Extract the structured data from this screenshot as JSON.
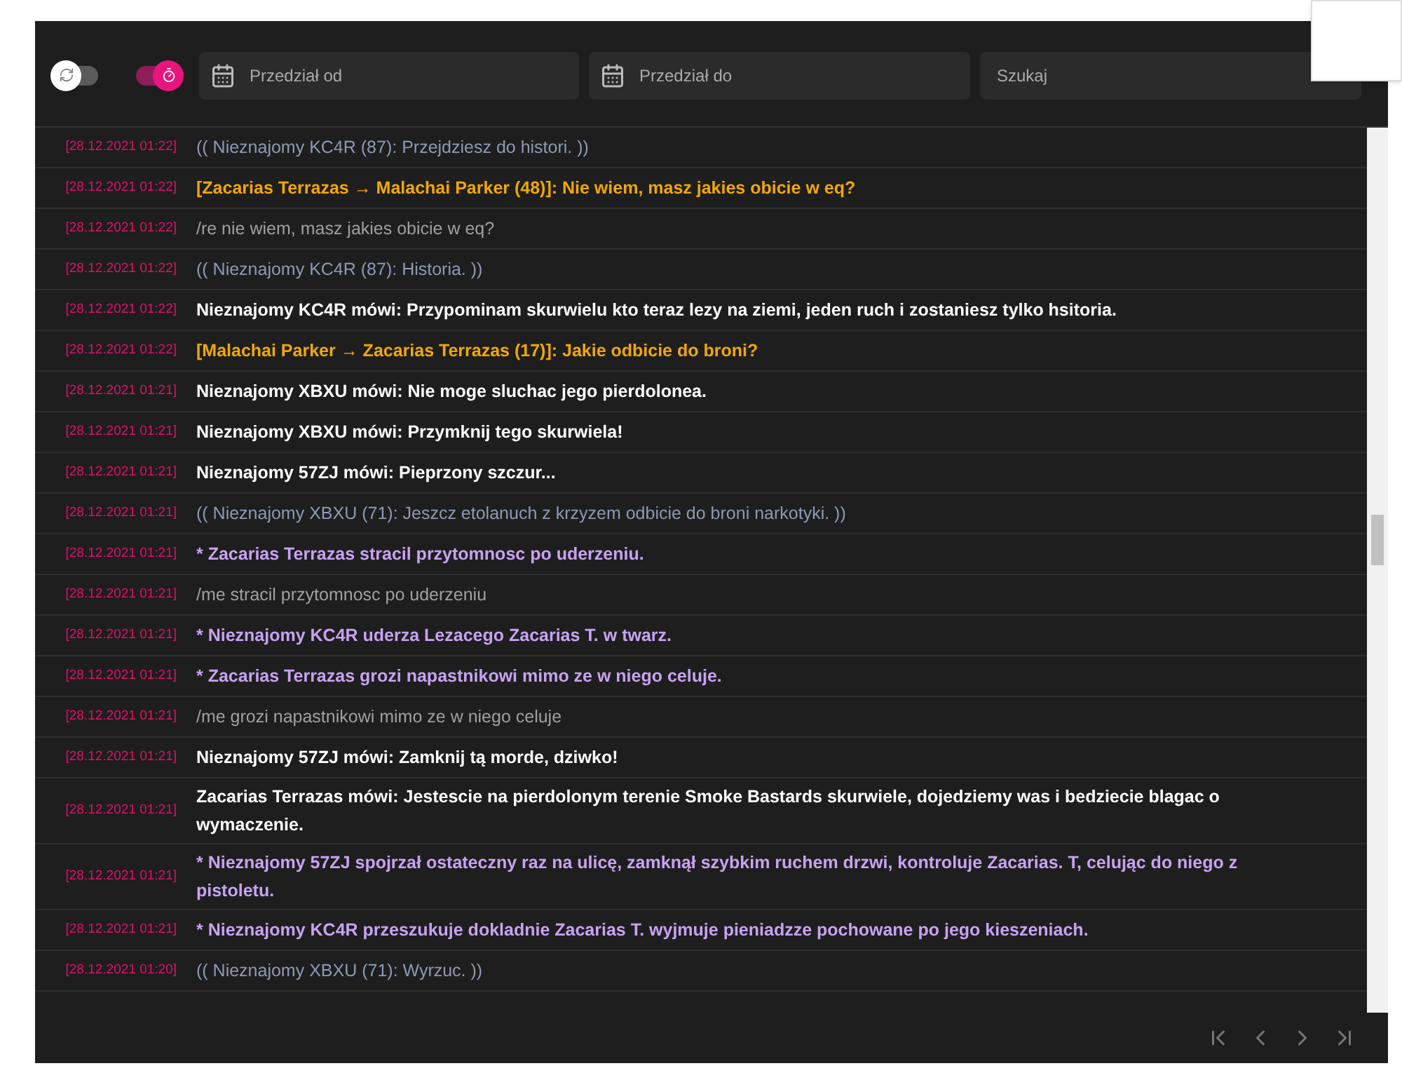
{
  "toolbar": {
    "auto_refresh": {
      "on": false
    },
    "timer": {
      "on": true
    },
    "date_from": {
      "placeholder": "Przedział od"
    },
    "date_to": {
      "placeholder": "Przedział do"
    },
    "search": {
      "placeholder": "Szukaj"
    }
  },
  "messages": [
    {
      "time": "[28.12.2021 01:22]",
      "kind": "ooc",
      "text": "(( Nieznajomy KC4R (87): Przejdziesz do histori. ))"
    },
    {
      "time": "[28.12.2021 01:22]",
      "kind": "pm",
      "text": "[Zacarias Terrazas → Malachai Parker (48)]: Nie wiem, masz jakies obicie w eq?"
    },
    {
      "time": "[28.12.2021 01:22]",
      "kind": "cmd",
      "text": "/re nie wiem, masz jakies obicie w eq?"
    },
    {
      "time": "[28.12.2021 01:22]",
      "kind": "ooc",
      "text": "(( Nieznajomy KC4R (87): Historia. ))"
    },
    {
      "time": "[28.12.2021 01:22]",
      "kind": "say",
      "text": "Nieznajomy KC4R mówi: Przypominam skurwielu kto teraz lezy na ziemi, jeden ruch i zostaniesz tylko hsitoria."
    },
    {
      "time": "[28.12.2021 01:22]",
      "kind": "pm",
      "text": "[Malachai Parker → Zacarias Terrazas (17)]: Jakie odbicie do broni?"
    },
    {
      "time": "[28.12.2021 01:21]",
      "kind": "say",
      "text": "Nieznajomy XBXU mówi: Nie moge sluchac jego pierdolonea."
    },
    {
      "time": "[28.12.2021 01:21]",
      "kind": "say",
      "text": "Nieznajomy XBXU mówi: Przymknij tego skurwiela!"
    },
    {
      "time": "[28.12.2021 01:21]",
      "kind": "say",
      "text": "Nieznajomy 57ZJ mówi: Pieprzony szczur..."
    },
    {
      "time": "[28.12.2021 01:21]",
      "kind": "ooc",
      "text": "(( Nieznajomy XBXU (71): Jeszcz etolanuch z krzyzem odbicie do broni narkotyki. ))"
    },
    {
      "time": "[28.12.2021 01:21]",
      "kind": "me",
      "text": "* Zacarias Terrazas stracil przytomnosc po uderzeniu."
    },
    {
      "time": "[28.12.2021 01:21]",
      "kind": "cmd",
      "text": "/me stracil przytomnosc po uderzeniu"
    },
    {
      "time": "[28.12.2021 01:21]",
      "kind": "me",
      "text": "* Nieznajomy KC4R uderza Lezacego Zacarias T. w twarz."
    },
    {
      "time": "[28.12.2021 01:21]",
      "kind": "me",
      "text": "* Zacarias Terrazas grozi napastnikowi mimo ze w niego celuje."
    },
    {
      "time": "[28.12.2021 01:21]",
      "kind": "cmd",
      "text": "/me grozi napastnikowi mimo ze w niego celuje"
    },
    {
      "time": "[28.12.2021 01:21]",
      "kind": "say",
      "text": "Nieznajomy 57ZJ mówi: Zamknij tą morde, dziwko!"
    },
    {
      "time": "[28.12.2021 01:21]",
      "kind": "say",
      "text": "Zacarias Terrazas mówi: Jestescie na pierdolonym terenie Smoke Bastards skurwiele, dojedziemy was i bedziecie blagac o wymaczenie."
    },
    {
      "time": "[28.12.2021 01:21]",
      "kind": "me",
      "text": "* Nieznajomy 57ZJ spojrzał ostateczny raz na ulicę, zamknął szybkim ruchem drzwi, kontroluje Zacarias. T, celując do niego z pistoletu."
    },
    {
      "time": "[28.12.2021 01:21]",
      "kind": "me",
      "text": "* Nieznajomy KC4R przeszukuje dokladnie Zacarias T. wyjmuje pieniadzze pochowane po jego kieszeniach."
    },
    {
      "time": "[28.12.2021 01:20]",
      "kind": "ooc",
      "text": "(( Nieznajomy XBXU (71): Wyrzuc. ))"
    }
  ]
}
